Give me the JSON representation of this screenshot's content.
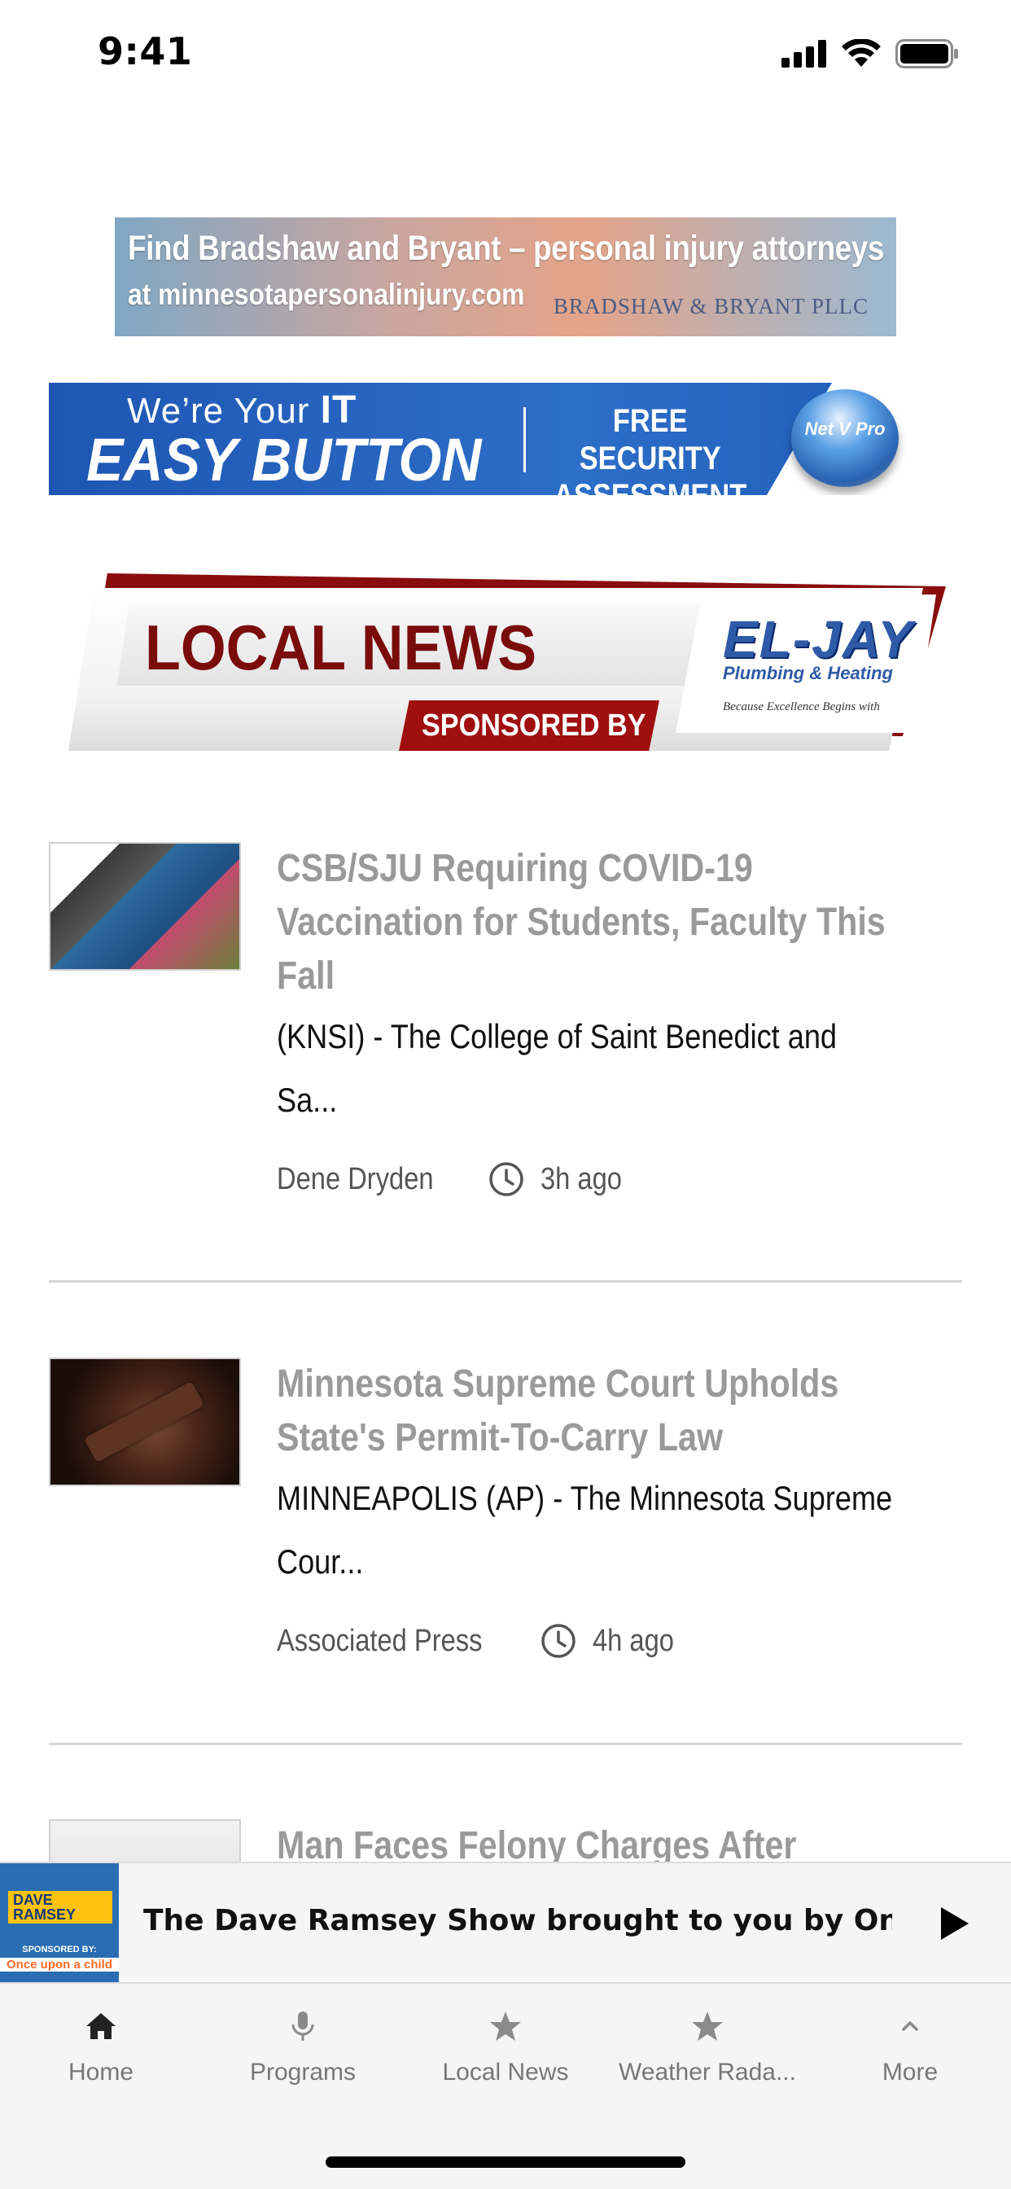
{
  "status_bar": {
    "time": "9:41"
  },
  "ads": {
    "bradshaw": {
      "line1": "Find Bradshaw and Bryant – personal injury attorneys",
      "line2": "at minnesotapersonalinjury.com",
      "brand": "BRADSHAW & BRYANT PLLC"
    },
    "netvpro": {
      "line1_prefix": "We’re Your",
      "line1_bold": "IT",
      "line2": "EASY BUTTON",
      "offer": "FREE SECURITY ASSESSMENT",
      "logo": "Net V Pro"
    }
  },
  "local_news_banner": {
    "title": "LOCAL NEWS",
    "sponsored": "SPONSORED BY",
    "sponsor_logo": "EL-JAY",
    "sponsor_sub": "Plumbing & Heating",
    "sponsor_tag": "Because Excellence Begins with"
  },
  "articles": [
    {
      "headline_lines": [
        "CSB/SJU Requiring COVID-19",
        "Vaccination for Students, Faculty This",
        "Fall"
      ],
      "excerpt_lines": [
        "(KNSI) - The College of Saint Benedict and",
        "Sa..."
      ],
      "author": "Dene Dryden",
      "time": "3h ago"
    },
    {
      "headline_lines": [
        "Minnesota Supreme Court Upholds",
        "State's Permit-To-Carry Law"
      ],
      "excerpt_lines": [
        "MINNEAPOLIS (AP) - The Minnesota Supreme",
        "Cour..."
      ],
      "author": "Associated Press",
      "time": "4h ago"
    },
    {
      "headline_lines": [
        "Man Faces Felony Charges After"
      ]
    }
  ],
  "player": {
    "title": "The Dave Ramsey Show brought to you by Once...",
    "art_logo": "DAVE RAMSEY",
    "art_sponsored": "SPONSORED BY:",
    "art_sponsor": "Once upon a child"
  },
  "tabs": [
    {
      "label": "Home",
      "icon": "home-icon",
      "active": true
    },
    {
      "label": "Programs",
      "icon": "microphone-icon"
    },
    {
      "label": "Local News",
      "icon": "star-icon"
    },
    {
      "label": "Weather Rada...",
      "icon": "star-icon"
    },
    {
      "label": "More",
      "icon": "chevron-up-icon"
    }
  ],
  "colors": {
    "headline": "#9a9a9a",
    "banner_red": "#8a0d0d",
    "tab_active": "#222222",
    "tab_inactive": "#8a8a8a"
  }
}
